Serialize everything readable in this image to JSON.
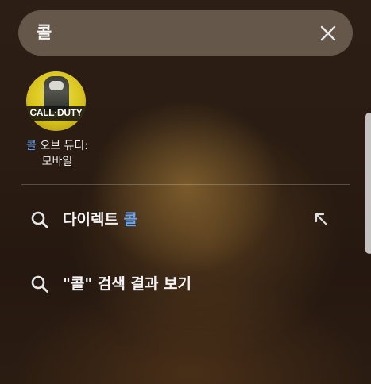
{
  "search": {
    "query": "콜",
    "clear_icon": "close-icon"
  },
  "app_result": {
    "icon_text": "CALL·DUTY",
    "label_highlight": "콜",
    "label_rest": " 오브 듀티:",
    "label_line2": "모바일"
  },
  "suggestions": [
    {
      "icon": "search-icon",
      "text_prefix": "다이렉트 ",
      "text_highlight": "콜",
      "action_icon": "arrow-up-left-icon"
    },
    {
      "icon": "search-icon",
      "text": "\"콜\" 검색 결과 보기"
    }
  ],
  "colors": {
    "highlight": "#6aa4ee",
    "search_bar": "#76685a"
  }
}
